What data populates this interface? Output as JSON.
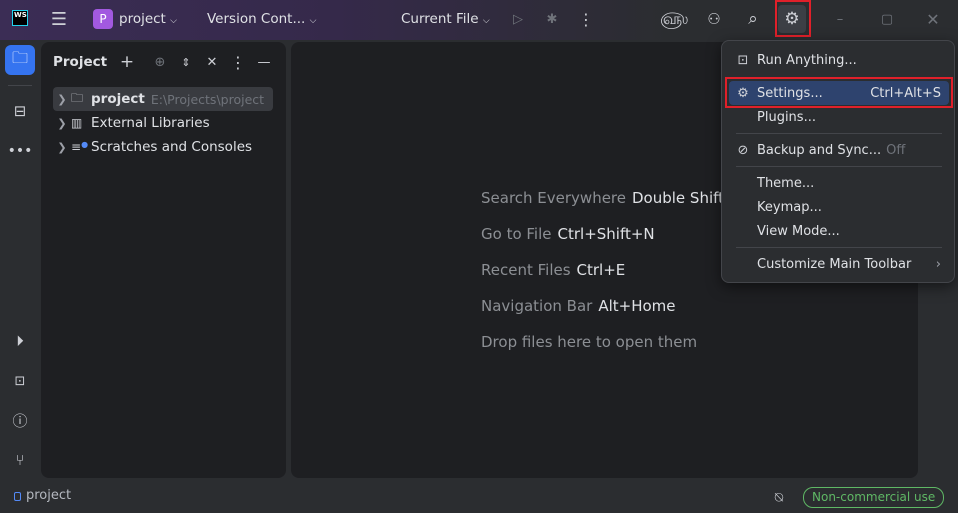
{
  "titlebar": {
    "app_logo": "WS",
    "project_initial": "P",
    "project_name": "project",
    "vcs": "Version Cont...",
    "run_config": "Current File"
  },
  "project_panel": {
    "title": "Project",
    "tree": [
      {
        "label": "project",
        "path": "E:\\Projects\\project",
        "icon": "folder-icon"
      },
      {
        "label": "External Libraries",
        "icon": "library-icon"
      },
      {
        "label": "Scratches and Consoles",
        "icon": "scratches-icon"
      }
    ]
  },
  "editor_hints": [
    {
      "label": "Search Everywhere",
      "key": "Double Shift"
    },
    {
      "label": "Go to File",
      "key": "Ctrl+Shift+N"
    },
    {
      "label": "Recent Files",
      "key": "Ctrl+E"
    },
    {
      "label": "Navigation Bar",
      "key": "Alt+Home"
    },
    {
      "label": "Drop files here to open them",
      "key": ""
    }
  ],
  "settings_menu": {
    "items": [
      {
        "label": "Run Anything..."
      },
      {
        "label": "Settings...",
        "shortcut": "Ctrl+Alt+S"
      },
      {
        "label": "Plugins..."
      },
      {
        "label": "Backup and Sync...",
        "state": "Off"
      },
      {
        "label": "Theme..."
      },
      {
        "label": "Keymap..."
      },
      {
        "label": "View Mode..."
      },
      {
        "label": "Customize Main Toolbar"
      }
    ]
  },
  "statusbar": {
    "project": "project",
    "license": "Non-commercial use"
  },
  "colors": {
    "accent": "#3574f0",
    "highlight": "#2e436e",
    "annotation": "#e0202a",
    "license": "#5fb865"
  }
}
